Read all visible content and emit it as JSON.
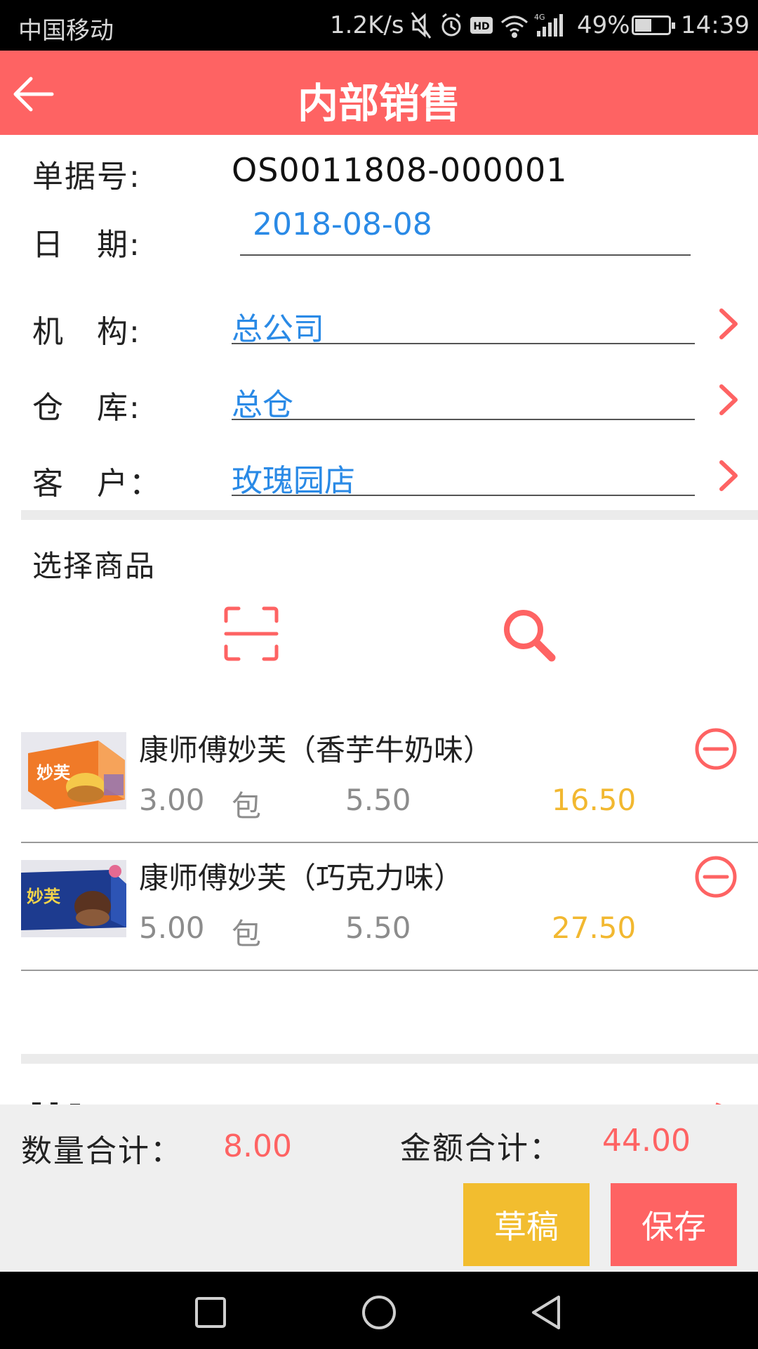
{
  "status_bar": {
    "carrier": "中国移动",
    "net_speed": "1.2K/s",
    "network_type": "4G",
    "battery_percent": "49%",
    "battery_level": 0.49,
    "time": "14:39",
    "icons": [
      "mute-icon",
      "alarm-icon",
      "hd-icon",
      "wifi-icon",
      "signal-icon",
      "battery-icon"
    ]
  },
  "header": {
    "title": "内部销售"
  },
  "form": {
    "doc_no_label": "单据号:",
    "doc_no": "OS0011808-000001",
    "date_label": "日　期:",
    "date": "2018-08-08",
    "org_label": "机　构:",
    "org": "总公司",
    "warehouse_label": "仓　库:",
    "warehouse": "总仓",
    "customer_label": "客　户：",
    "customer": "玫瑰园店"
  },
  "goods": {
    "section_title": "选择商品",
    "items": [
      {
        "name": "康师傅妙芙（香芋牛奶味）",
        "qty": "3.00",
        "unit": "包",
        "price": "5.50",
        "amount": "16.50"
      },
      {
        "name": "康师傅妙芙（巧克力味）",
        "qty": "5.00",
        "unit": "包",
        "price": "5.50",
        "amount": "27.50"
      }
    ]
  },
  "footer": {
    "qty_total_label": "数量合计：",
    "qty_total": "8.00",
    "amount_total_label": "金额合计：",
    "amount_total": "44.00",
    "draft_button": "草稿",
    "save_button": "保存"
  },
  "colors": {
    "primary": "#fe6363",
    "link": "#2a8ae6",
    "amount": "#f2b830",
    "draft": "#f2bd2f"
  }
}
